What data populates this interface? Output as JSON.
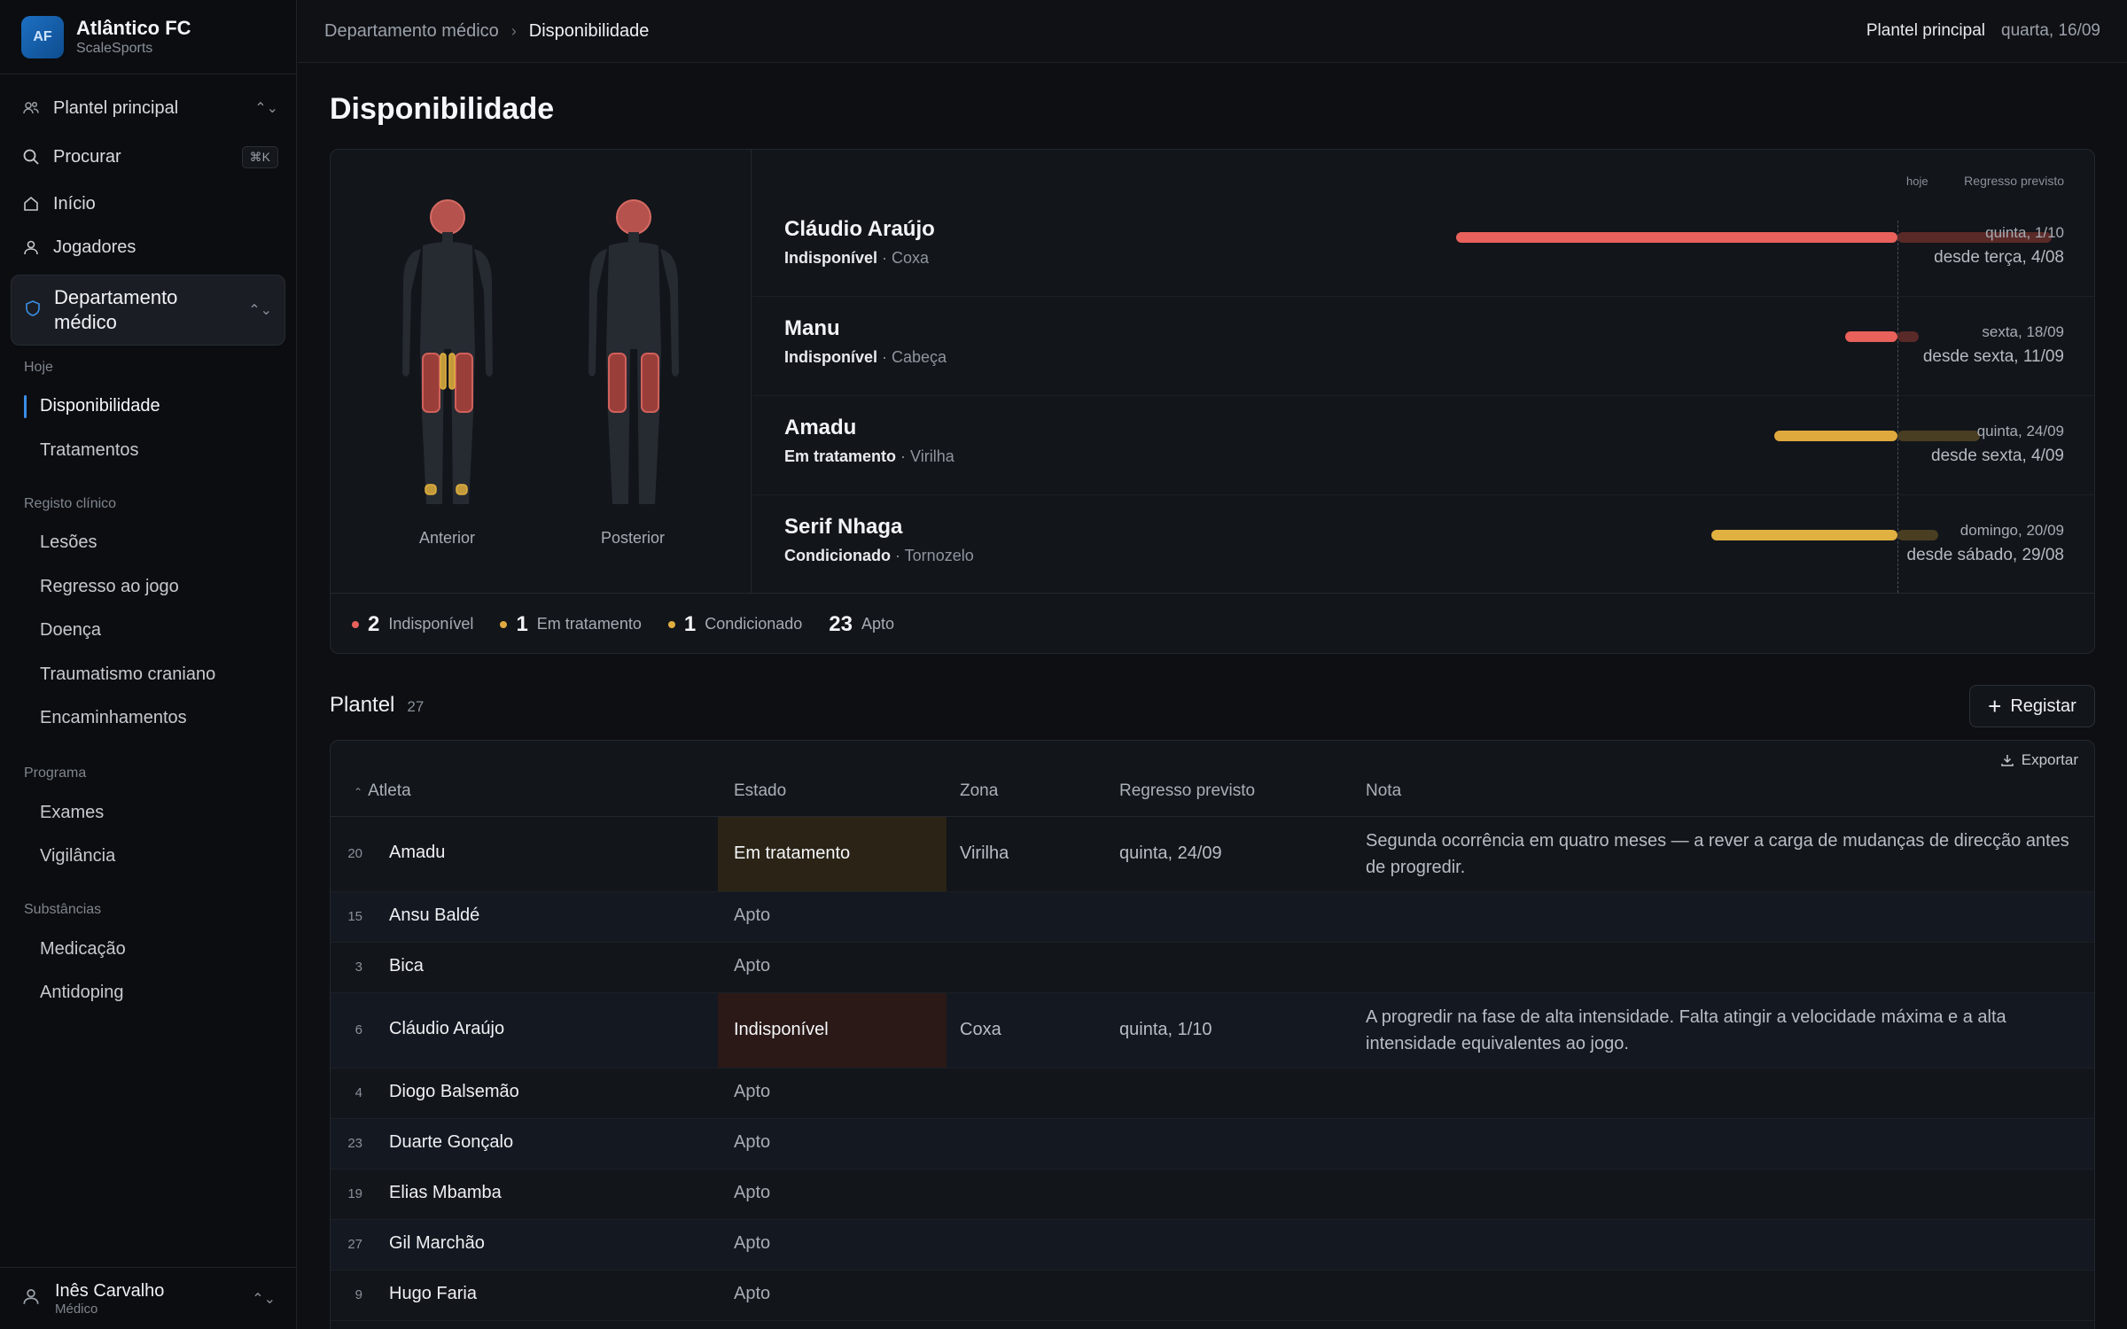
{
  "brand": {
    "logo": "AF",
    "name": "Atlântico FC",
    "sub": "ScaleSports"
  },
  "sidebar": {
    "squad_select": "Plantel principal",
    "search": "Procurar",
    "search_kbd": "⌘K",
    "home": "Início",
    "players": "Jogadores",
    "active_section": "Departamento médico",
    "groups": [
      {
        "label": "Hoje",
        "items": [
          "Disponibilidade",
          "Tratamentos"
        ]
      },
      {
        "label": "Registo clínico",
        "items": [
          "Lesões",
          "Regresso ao jogo",
          "Doença",
          "Traumatismo craniano",
          "Encaminhamentos"
        ]
      },
      {
        "label": "Programa",
        "items": [
          "Exames",
          "Vigilância"
        ]
      },
      {
        "label": "Substâncias",
        "items": [
          "Medicação",
          "Antidoping"
        ]
      }
    ],
    "user": {
      "name": "Inês Carvalho",
      "role": "Médico"
    }
  },
  "topbar": {
    "crumbs": [
      "Departamento médico",
      "Disponibilidade"
    ],
    "squad": "Plantel principal",
    "date": "quarta, 16/09"
  },
  "page": {
    "title": "Disponibilidade"
  },
  "availability": {
    "figure_labels": [
      "Anterior",
      "Posterior"
    ],
    "today_label": "hoje",
    "return_header": "Regresso previsto",
    "rows": [
      {
        "name": "Cláudio Araújo",
        "status": "Indisponível",
        "zone": "Coxa",
        "return": "quinta, 1/10",
        "since": "desde terça, 4/08",
        "status_color": "#e8615a"
      },
      {
        "name": "Manu",
        "status": "Indisponível",
        "zone": "Cabeça",
        "return": "sexta, 18/09",
        "since": "desde sexta, 11/09",
        "status_color": "#e8615a"
      },
      {
        "name": "Amadu",
        "status": "Em tratamento",
        "zone": "Virilha",
        "return": "quinta, 24/09",
        "since": "desde sexta, 4/09",
        "status_color": "#e0a93e"
      },
      {
        "name": "Serif Nhaga",
        "status": "Condicionado",
        "zone": "Tornozelo",
        "return": "domingo, 20/09",
        "since": "desde sábado, 29/08",
        "status_color": "#e0b040"
      }
    ],
    "summary": [
      {
        "count": "2",
        "label": "Indisponível",
        "color": "#e8615a"
      },
      {
        "count": "1",
        "label": "Em tratamento",
        "color": "#e0a93e"
      },
      {
        "count": "1",
        "label": "Condicionado",
        "color": "#e0b040"
      },
      {
        "count": "23",
        "label": "Apto",
        "color": ""
      }
    ]
  },
  "squad": {
    "title": "Plantel",
    "count": "27",
    "register": "Registar",
    "export": "Exportar",
    "columns": [
      "Atleta",
      "Estado",
      "Zona",
      "Regresso previsto",
      "Nota"
    ],
    "rows": [
      {
        "num": "20",
        "name": "Amadu",
        "state": "Em tratamento",
        "zone": "Virilha",
        "return": "quinta, 24/09",
        "note": "Segunda ocorrência em quatro meses — a rever a carga de mudanças de direcção antes de progredir."
      },
      {
        "num": "15",
        "name": "Ansu Baldé",
        "state": "Apto",
        "zone": "",
        "return": "",
        "note": ""
      },
      {
        "num": "3",
        "name": "Bica",
        "state": "Apto",
        "zone": "",
        "return": "",
        "note": ""
      },
      {
        "num": "6",
        "name": "Cláudio Araújo",
        "state": "Indisponível",
        "zone": "Coxa",
        "return": "quinta, 1/10",
        "note": "A progredir na fase de alta intensidade. Falta atingir a velocidade máxima e a alta intensidade equivalentes ao jogo."
      },
      {
        "num": "4",
        "name": "Diogo Balsemão",
        "state": "Apto",
        "zone": "",
        "return": "",
        "note": ""
      },
      {
        "num": "23",
        "name": "Duarte Gonçalo",
        "state": "Apto",
        "zone": "",
        "return": "",
        "note": ""
      },
      {
        "num": "19",
        "name": "Elias Mbamba",
        "state": "Apto",
        "zone": "",
        "return": "",
        "note": ""
      },
      {
        "num": "27",
        "name": "Gil Marchão",
        "state": "Apto",
        "zone": "",
        "return": "",
        "note": ""
      },
      {
        "num": "9",
        "name": "Hugo Faria",
        "state": "Apto",
        "zone": "",
        "return": "",
        "note": ""
      }
    ]
  }
}
